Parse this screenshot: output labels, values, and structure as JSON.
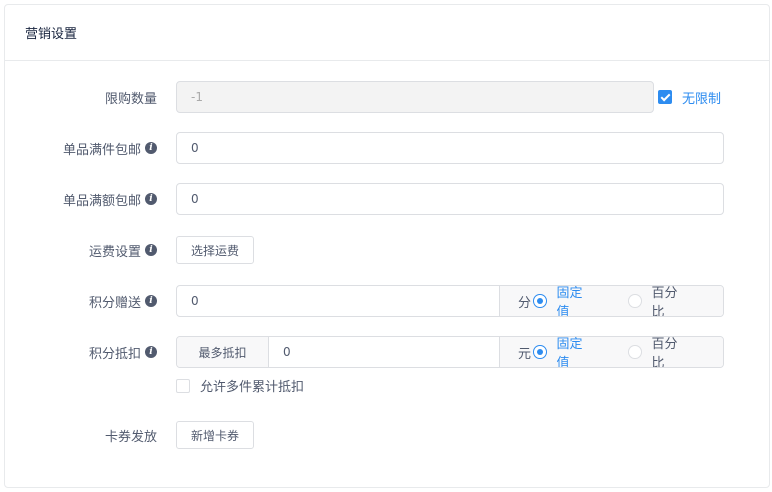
{
  "card": {
    "title": "营销设置"
  },
  "purchase_limit": {
    "label": "限购数量",
    "value": "-1",
    "unlimited_label": "无限制",
    "unlimited_checked": true
  },
  "free_shipping_qty": {
    "label": "单品满件包邮",
    "value": "0"
  },
  "free_shipping_amount": {
    "label": "单品满额包邮",
    "value": "0"
  },
  "shipping": {
    "label": "运费设置",
    "button": "选择运费"
  },
  "points_gift": {
    "label": "积分赠送",
    "value": "0",
    "unit": "分",
    "options": [
      "固定值",
      "百分比"
    ],
    "selected": "固定值"
  },
  "points_deduct": {
    "label": "积分抵扣",
    "prefix": "最多抵扣",
    "value": "0",
    "unit": "元",
    "options": [
      "固定值",
      "百分比"
    ],
    "selected": "固定值",
    "multi_label": "允许多件累计抵扣",
    "multi_checked": false
  },
  "coupon": {
    "label": "卡券发放",
    "button": "新增卡券"
  },
  "colors": {
    "accent": "#2d8cf0",
    "border": "#dcdee2",
    "text": "#515a6e",
    "addon_bg": "#f8f8f9"
  }
}
